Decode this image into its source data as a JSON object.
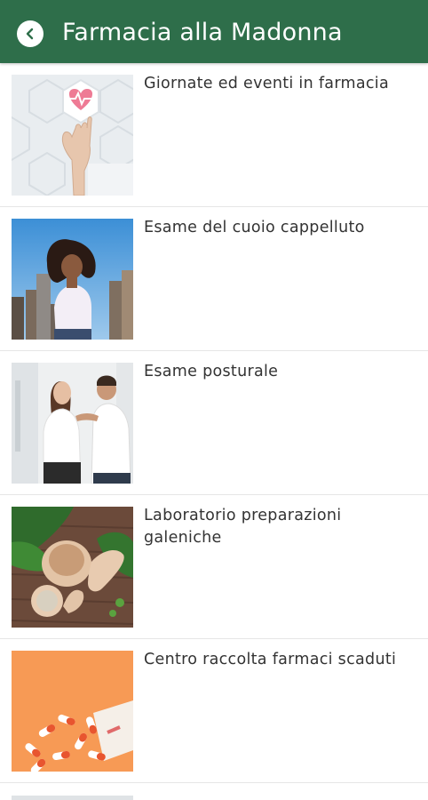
{
  "appbar": {
    "title": "Farmacia alla Madonna",
    "back_icon": "chevron-left-icon",
    "color": "#2e6e4a"
  },
  "items": [
    {
      "title": "Giornate ed eventi in farmacia"
    },
    {
      "title": "Esame del cuoio cappelluto"
    },
    {
      "title": "Esame posturale"
    },
    {
      "title": "Laboratorio preparazioni galeniche"
    },
    {
      "title": "Centro raccolta farmaci scaduti"
    }
  ]
}
